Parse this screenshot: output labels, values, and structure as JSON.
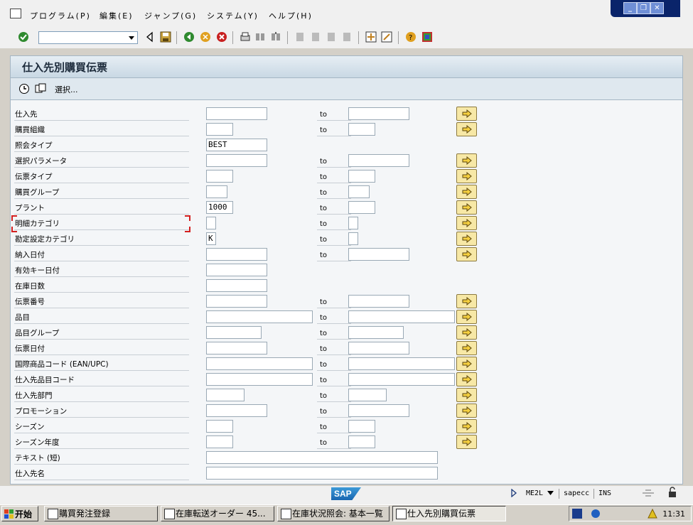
{
  "menu": [
    "プログラム(P)",
    "編集(E)",
    "ジャンプ(G)",
    "システム(Y)",
    "ヘルプ(H)"
  ],
  "screen_title": "仕入先別購買伝票",
  "app_toolbar": {
    "select_label": "選択..."
  },
  "to_label": "to",
  "rows": [
    {
      "label": "仕入先",
      "low": "",
      "high": ""
    },
    {
      "label": "購買組織",
      "low": "",
      "high": ""
    },
    {
      "label": "照会タイプ",
      "low": "BEST"
    },
    {
      "label": "選択パラメータ",
      "low": "",
      "high": ""
    },
    {
      "label": "伝票タイプ",
      "low": "",
      "high": ""
    },
    {
      "label": "購買グループ",
      "low": "",
      "high": ""
    },
    {
      "label": "プラント",
      "low": "1000",
      "high": ""
    },
    {
      "label": "明細カテゴリ",
      "low": "",
      "high": ""
    },
    {
      "label": "勘定設定カテゴリ",
      "low": "K",
      "high": ""
    },
    {
      "label": "納入日付",
      "low": "",
      "high": ""
    },
    {
      "label": "有効キー日付",
      "low": ""
    },
    {
      "label": "在庫日数",
      "low": ""
    },
    {
      "label": "伝票番号",
      "low": "",
      "high": ""
    },
    {
      "label": "品目",
      "low": "",
      "high": ""
    },
    {
      "label": "品目グループ",
      "low": "",
      "high": ""
    },
    {
      "label": "伝票日付",
      "low": "",
      "high": ""
    },
    {
      "label": "国際商品コード (EAN/UPC)",
      "low": "",
      "high": ""
    },
    {
      "label": "仕入先品目コード",
      "low": "",
      "high": ""
    },
    {
      "label": "仕入先部門",
      "low": "",
      "high": ""
    },
    {
      "label": "プロモーション",
      "low": "",
      "high": ""
    },
    {
      "label": "シーズン",
      "low": "",
      "high": ""
    },
    {
      "label": "シーズン年度",
      "low": "",
      "high": ""
    },
    {
      "label": "テキスト (短)",
      "low": ""
    },
    {
      "label": "仕入先名",
      "low": ""
    }
  ],
  "status": {
    "logo": "SAP",
    "transaction": "ME2L",
    "system": "sapecc",
    "mode": "INS"
  },
  "taskbar": {
    "start": "开始",
    "tasks": [
      "購買発注登録",
      "在庫転送オーダー 45...",
      "在庫状況照会: 基本一覧",
      "仕入先別購買伝票"
    ],
    "clock": "11:31"
  }
}
